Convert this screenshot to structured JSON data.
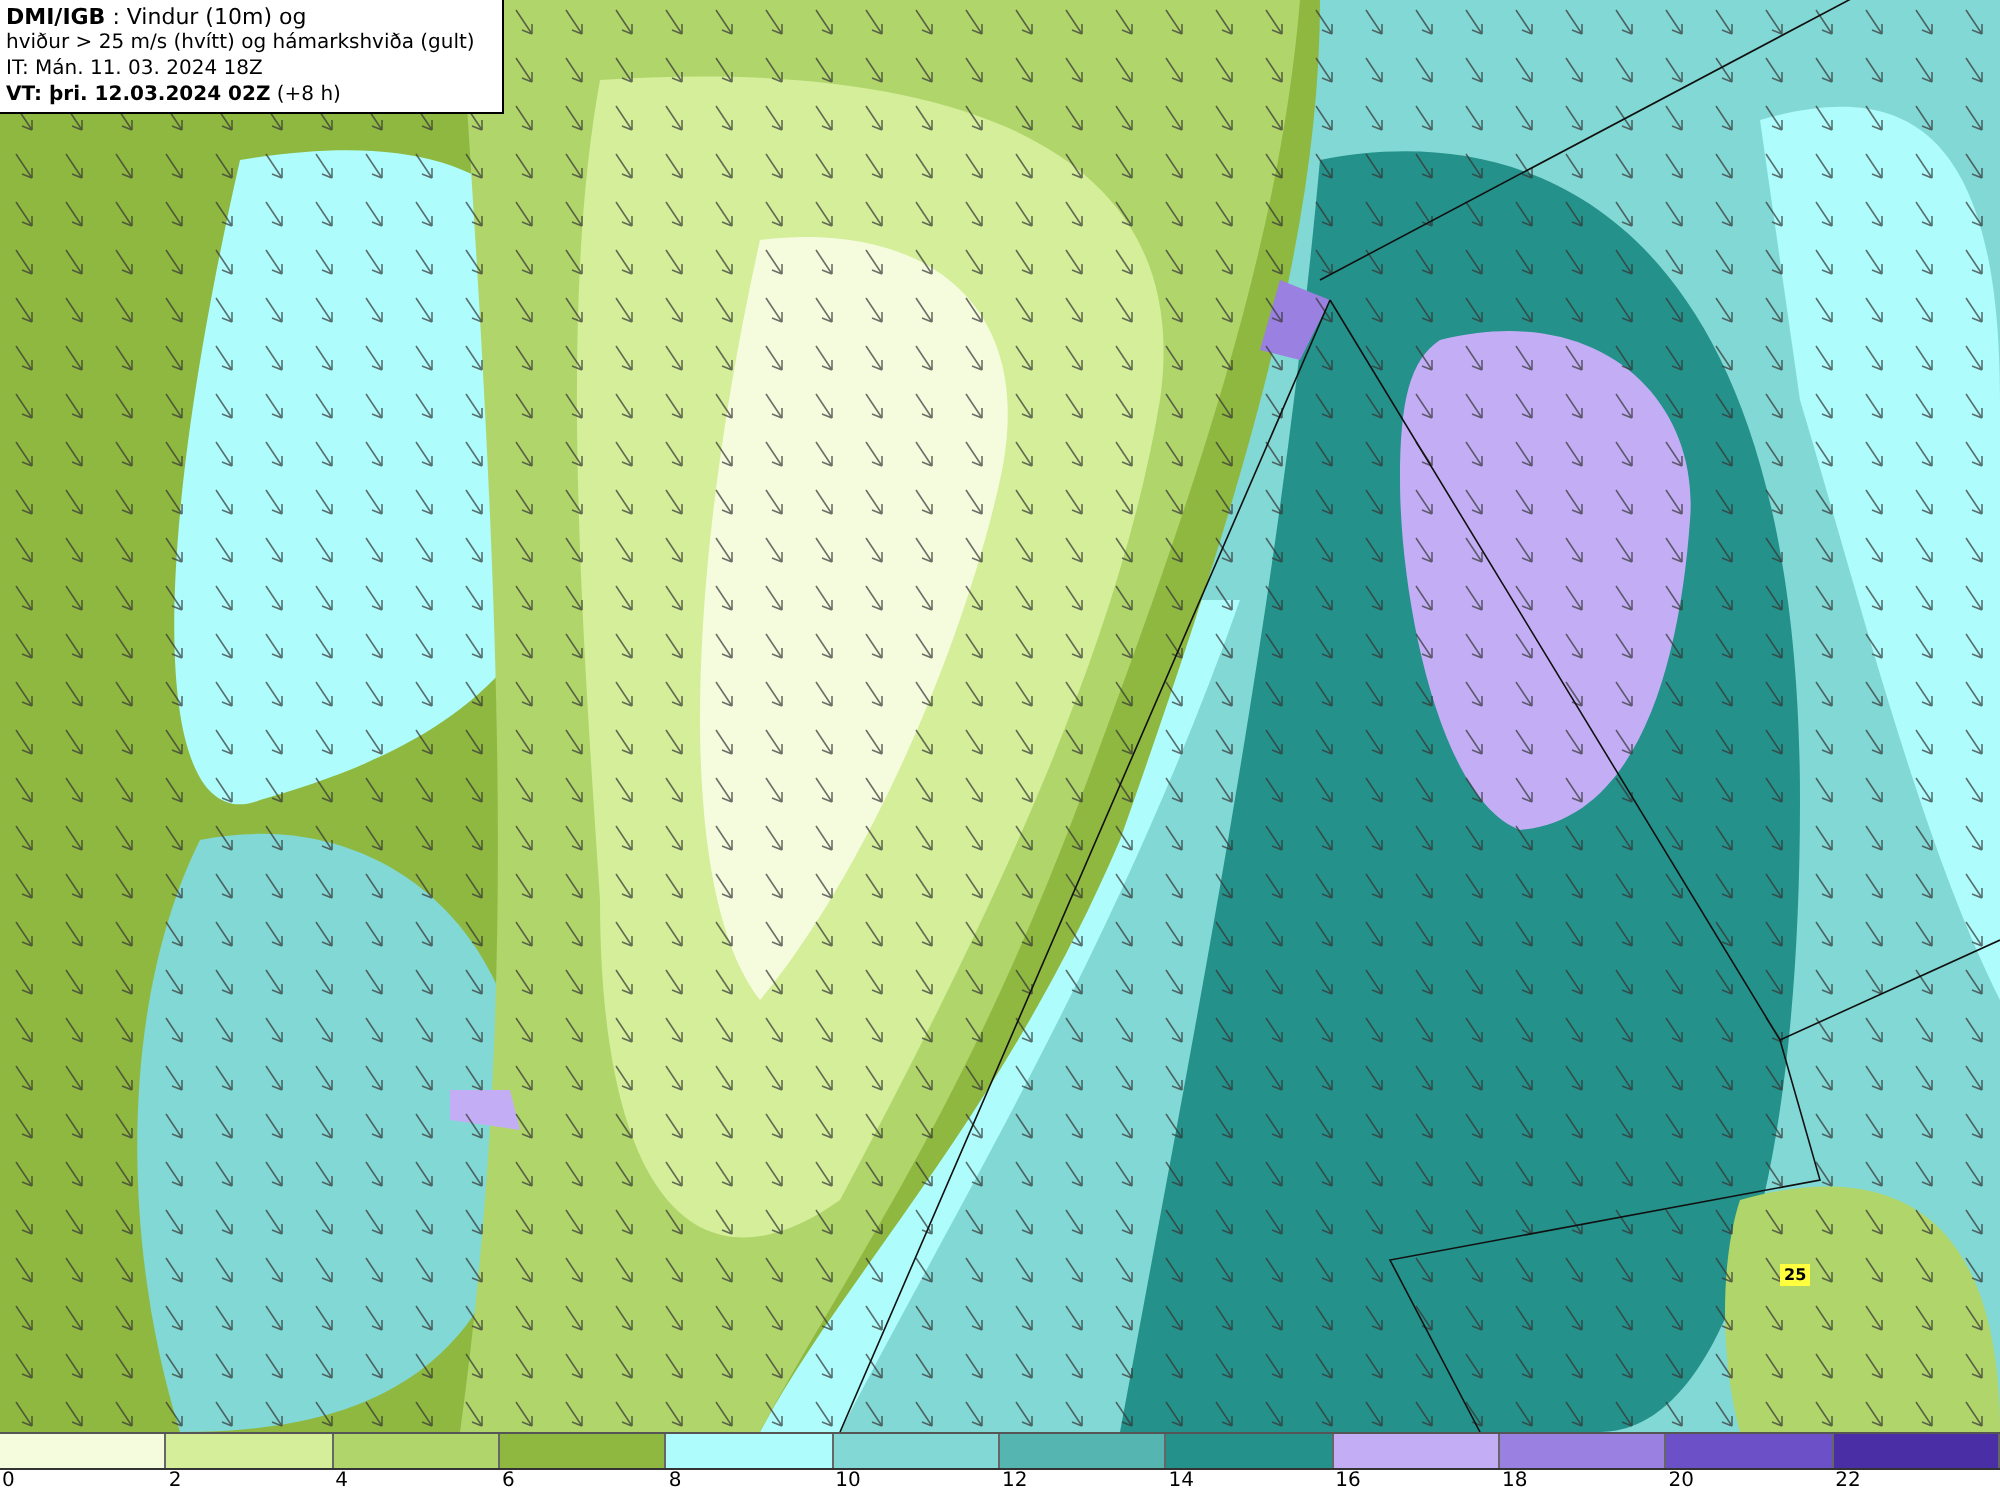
{
  "title_box": {
    "lines": [
      "**DMI/IGB** : Vindur (10m) og",
      "hviður > 25 m/s (hvítt) og hámarkshviða (gult)",
      "IT: Mán. 11. 03. 2024 18Z",
      "**VT: þri. 12.03.2024 02Z** (+8 h)"
    ]
  },
  "map": {
    "gust_labels": [
      "25"
    ]
  },
  "legend": {
    "bins": [
      {
        "label": "0",
        "color": "#f5fbdd"
      },
      {
        "label": "2",
        "color": "#d4ee9a"
      },
      {
        "label": "4",
        "color": "#b0d56a"
      },
      {
        "label": "6",
        "color": "#8fb840"
      },
      {
        "label": "8",
        "color": "#aefcfc"
      },
      {
        "label": "10",
        "color": "#82d8d4"
      },
      {
        "label": "12",
        "color": "#55b6b1"
      },
      {
        "label": "14",
        "color": "#25918b"
      },
      {
        "label": "16",
        "color": "#c3aef6"
      },
      {
        "label": "18",
        "color": "#9a80e0"
      },
      {
        "label": "20",
        "color": "#6c50c8"
      },
      {
        "label": "22",
        "color": "#4a2ea6"
      }
    ]
  }
}
